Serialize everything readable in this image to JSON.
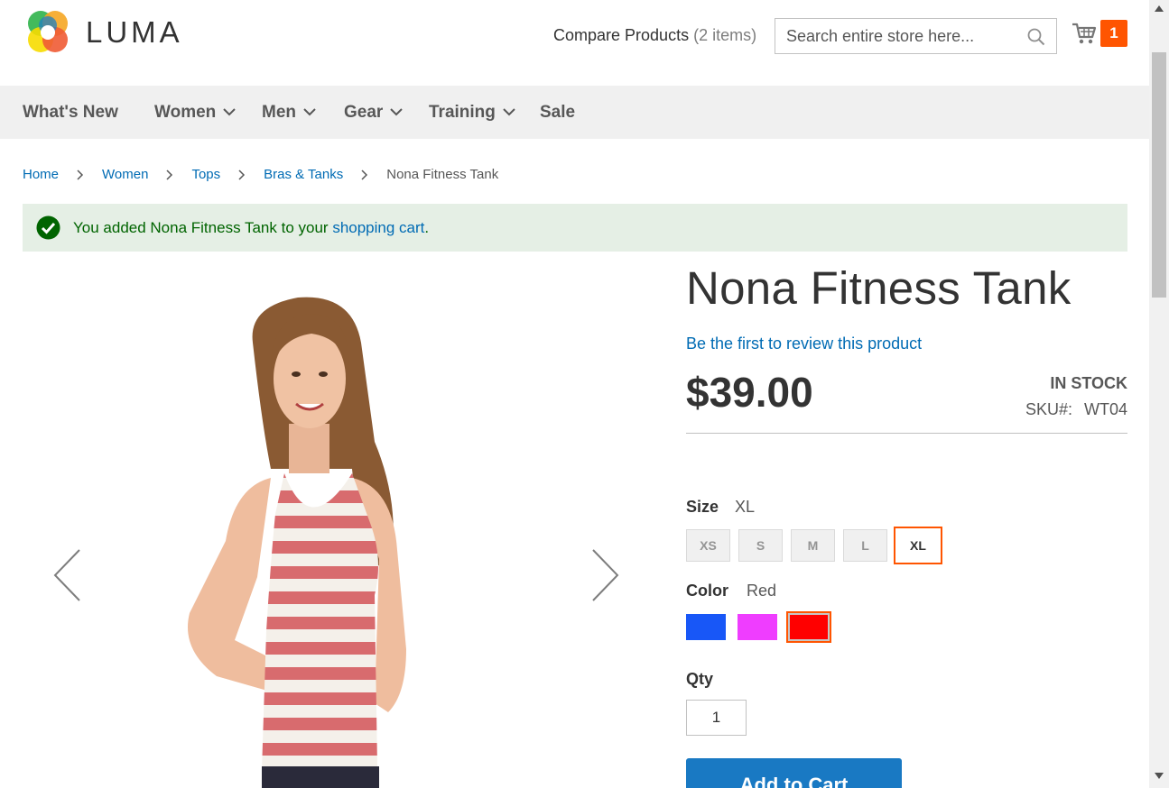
{
  "header": {
    "logo_text": "LUMA",
    "compare_label": "Compare Products",
    "compare_count": "(2 items)",
    "search_placeholder": "Search entire store here...",
    "cart_count": "1"
  },
  "nav": {
    "items": [
      {
        "label": "What's New",
        "has_dropdown": false
      },
      {
        "label": "Women",
        "has_dropdown": true
      },
      {
        "label": "Men",
        "has_dropdown": true
      },
      {
        "label": "Gear",
        "has_dropdown": true
      },
      {
        "label": "Training",
        "has_dropdown": true
      },
      {
        "label": "Sale",
        "has_dropdown": false
      }
    ]
  },
  "breadcrumb": {
    "items": [
      "Home",
      "Women",
      "Tops",
      "Bras & Tanks"
    ],
    "current": "Nona Fitness Tank"
  },
  "message": {
    "prefix": "You added Nona Fitness Tank to your ",
    "link": "shopping cart",
    "suffix": "."
  },
  "product": {
    "title": "Nona Fitness Tank",
    "review_link": "Be the first to review this product",
    "price": "$39.00",
    "stock": "IN STOCK",
    "sku_label": "SKU#:",
    "sku_value": "WT04",
    "size_label": "Size",
    "size_selected": "XL",
    "sizes": [
      "XS",
      "S",
      "M",
      "L",
      "XL"
    ],
    "color_label": "Color",
    "color_selected": "Red",
    "colors": [
      {
        "name": "Blue",
        "hex": "#1857f7"
      },
      {
        "name": "Purple",
        "hex": "#ef3dff"
      },
      {
        "name": "Red",
        "hex": "#ff0000"
      }
    ],
    "qty_label": "Qty",
    "qty_value": "1",
    "add_to_cart": "Add to Cart"
  },
  "colors": {
    "accent": "#ff5501",
    "link": "#006bb4",
    "button": "#1979c3",
    "success_bg": "#e5efe5"
  }
}
